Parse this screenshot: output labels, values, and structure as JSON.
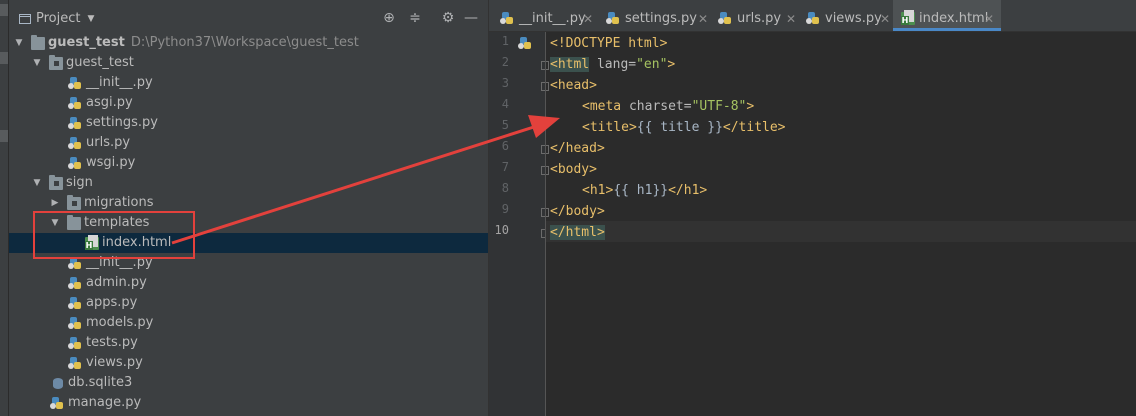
{
  "project_panel": {
    "title": "Project",
    "tree": [
      {
        "name": "guest_test",
        "path": "D:\\Python37\\Workspace\\guest_test",
        "type": "folder",
        "expanded": true,
        "bold": true
      },
      {
        "name": "guest_test",
        "type": "folder",
        "expanded": true
      },
      {
        "name": "__init__.py",
        "type": "py"
      },
      {
        "name": "asgi.py",
        "type": "py"
      },
      {
        "name": "settings.py",
        "type": "py"
      },
      {
        "name": "urls.py",
        "type": "py"
      },
      {
        "name": "wsgi.py",
        "type": "py"
      },
      {
        "name": "sign",
        "type": "folder",
        "expanded": true
      },
      {
        "name": "migrations",
        "type": "folder",
        "expanded": false
      },
      {
        "name": "templates",
        "type": "folder",
        "expanded": true
      },
      {
        "name": "index.html",
        "type": "html",
        "selected": true
      },
      {
        "name": "__init__.py",
        "type": "py"
      },
      {
        "name": "admin.py",
        "type": "py"
      },
      {
        "name": "apps.py",
        "type": "py"
      },
      {
        "name": "models.py",
        "type": "py"
      },
      {
        "name": "tests.py",
        "type": "py"
      },
      {
        "name": "views.py",
        "type": "py"
      },
      {
        "name": "db.sqlite3",
        "type": "db"
      },
      {
        "name": "manage.py",
        "type": "py"
      }
    ]
  },
  "editor": {
    "tabs": [
      {
        "label": "__init__.py"
      },
      {
        "label": "settings.py"
      },
      {
        "label": "urls.py"
      },
      {
        "label": "views.py"
      },
      {
        "label": "index.html",
        "active": true
      }
    ],
    "line_numbers": [
      "1",
      "2",
      "3",
      "4",
      "5",
      "6",
      "7",
      "8",
      "9",
      "10"
    ],
    "current_line": "10",
    "lines": {
      "l1": {
        "a": "<!DOCTYPE html>"
      },
      "l2": {
        "a": "<html",
        "b": " lang=",
        "c": "\"en\"",
        "d": ">"
      },
      "l3": {
        "a": "<head>"
      },
      "l4": {
        "a": "<meta",
        "b": " charset=",
        "c": "\"UTF-8\"",
        "d": ">"
      },
      "l5": {
        "a": "<title>",
        "b": "{{ title }}",
        "c": "</title>"
      },
      "l6": {
        "a": "</head>"
      },
      "l7": {
        "a": "<body>"
      },
      "l8": {
        "a": "<h1>",
        "b": "{{ h1}}",
        "c": "</h1>"
      },
      "l9": {
        "a": "</body>"
      },
      "l10": {
        "a": "</html>"
      }
    }
  },
  "annotation": {
    "box_color": "#e3413c",
    "arrow_color": "#e3413c"
  }
}
